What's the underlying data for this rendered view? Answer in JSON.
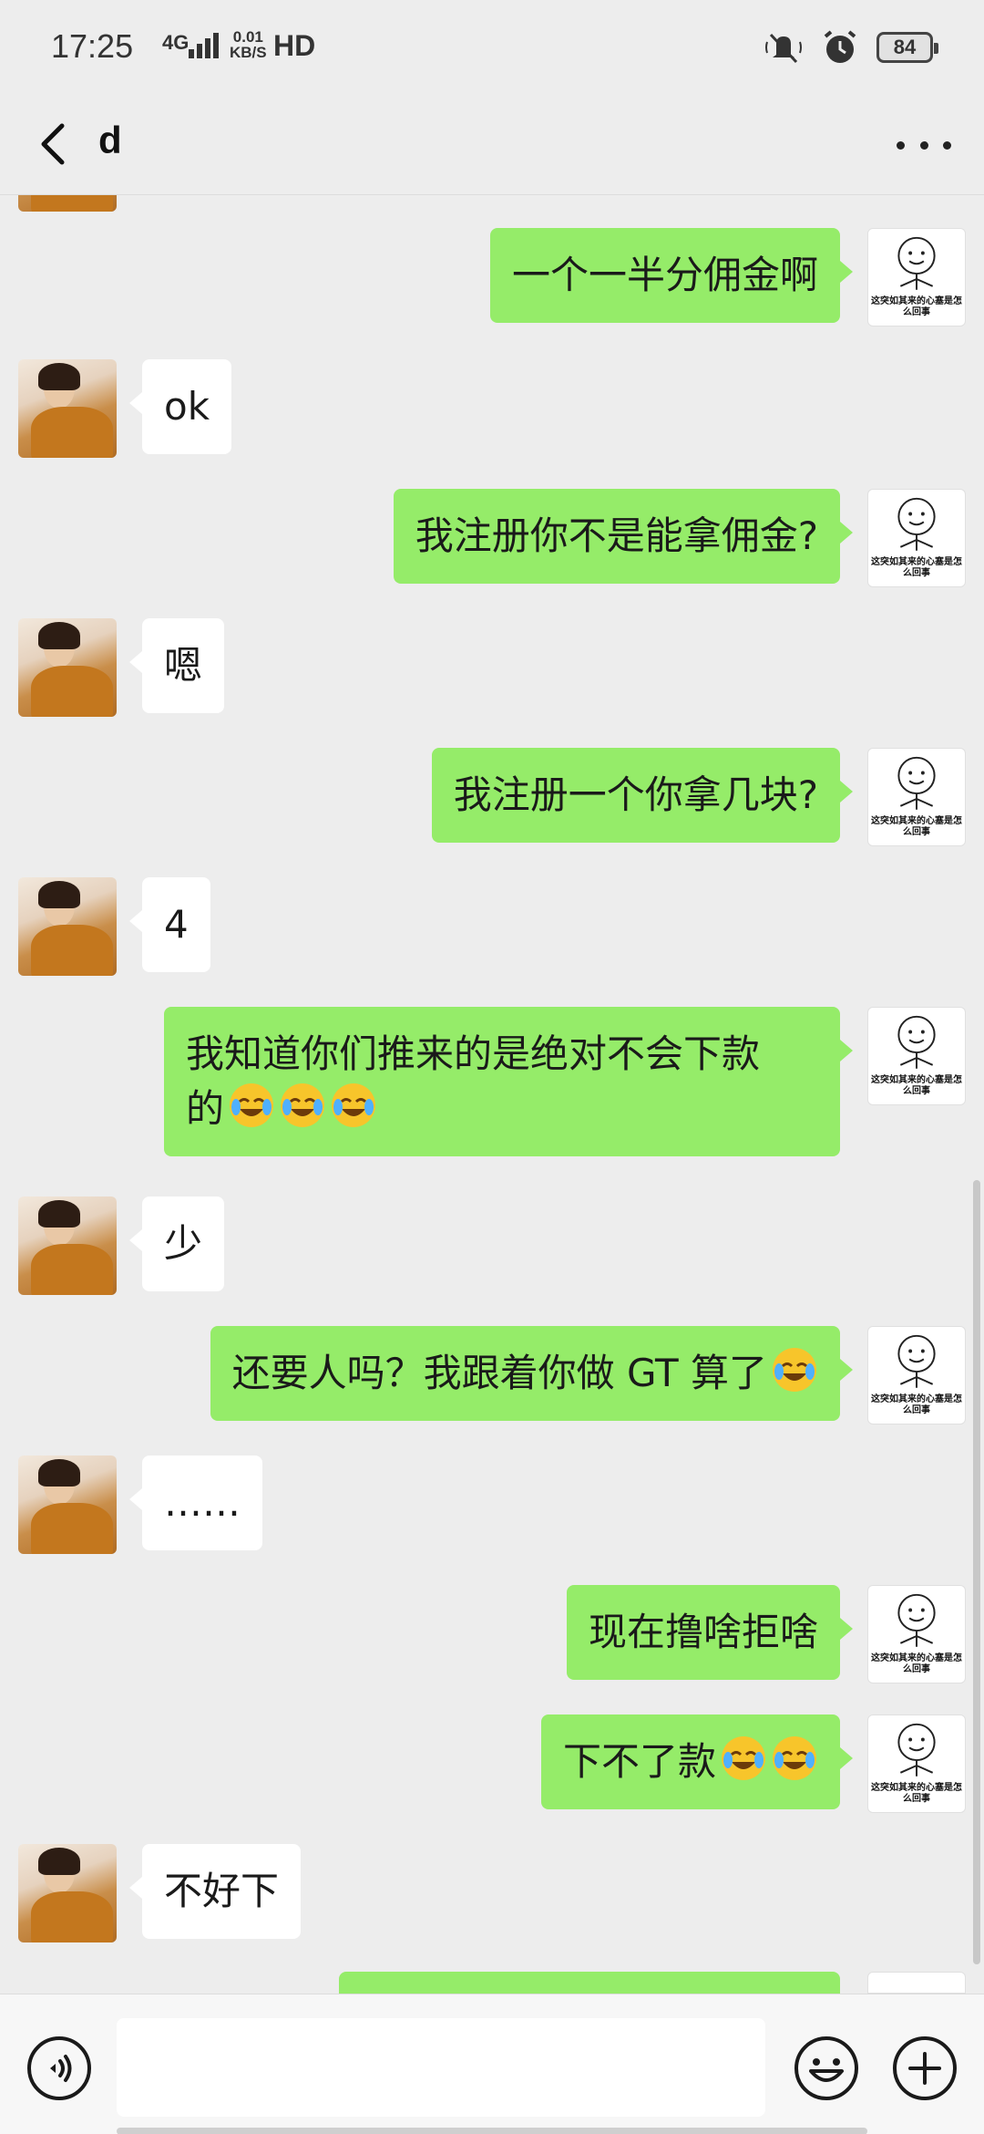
{
  "status_bar": {
    "time": "17:25",
    "network": "4G",
    "speed_top": "0.01",
    "speed_bottom": "KB/S",
    "hd": "HD",
    "battery": "84"
  },
  "header": {
    "title": "d"
  },
  "avatar_caption": "这突如其来的心塞是怎么回事",
  "messages": [
    {
      "side": "out",
      "text": "一个一半分佣金啊"
    },
    {
      "side": "in",
      "text": "ok"
    },
    {
      "side": "out",
      "text": "我注册你不是能拿佣金?"
    },
    {
      "side": "in",
      "text": "嗯"
    },
    {
      "side": "out",
      "text": "我注册一个你拿几块?"
    },
    {
      "side": "in",
      "text": "4"
    },
    {
      "side": "out",
      "text_line1": "我知道你们推来的是绝对不会下款",
      "text_line2": "的",
      "emoji_count": 3
    },
    {
      "side": "in",
      "text": "少"
    },
    {
      "side": "out",
      "text": "还要人吗？我跟着你做 GT 算了",
      "emoji_count": 1
    },
    {
      "side": "in",
      "text": "……"
    },
    {
      "side": "out",
      "text": "现在撸啥拒啥"
    },
    {
      "side": "out",
      "text": "下不了款",
      "emoji_count": 2
    },
    {
      "side": "in",
      "text": "不好下"
    }
  ],
  "input_bar": {
    "placeholder": ""
  },
  "colors": {
    "background": "#ededed",
    "outgoing_bubble": "#95ec69",
    "incoming_bubble": "#ffffff"
  },
  "icons": [
    "back-arrow-icon",
    "more-dots-icon",
    "voice-icon",
    "emoji-icon",
    "plus-icon",
    "mute-icon",
    "alarm-icon",
    "signal-icon",
    "battery-icon",
    "laughing-crying-emoji"
  ]
}
